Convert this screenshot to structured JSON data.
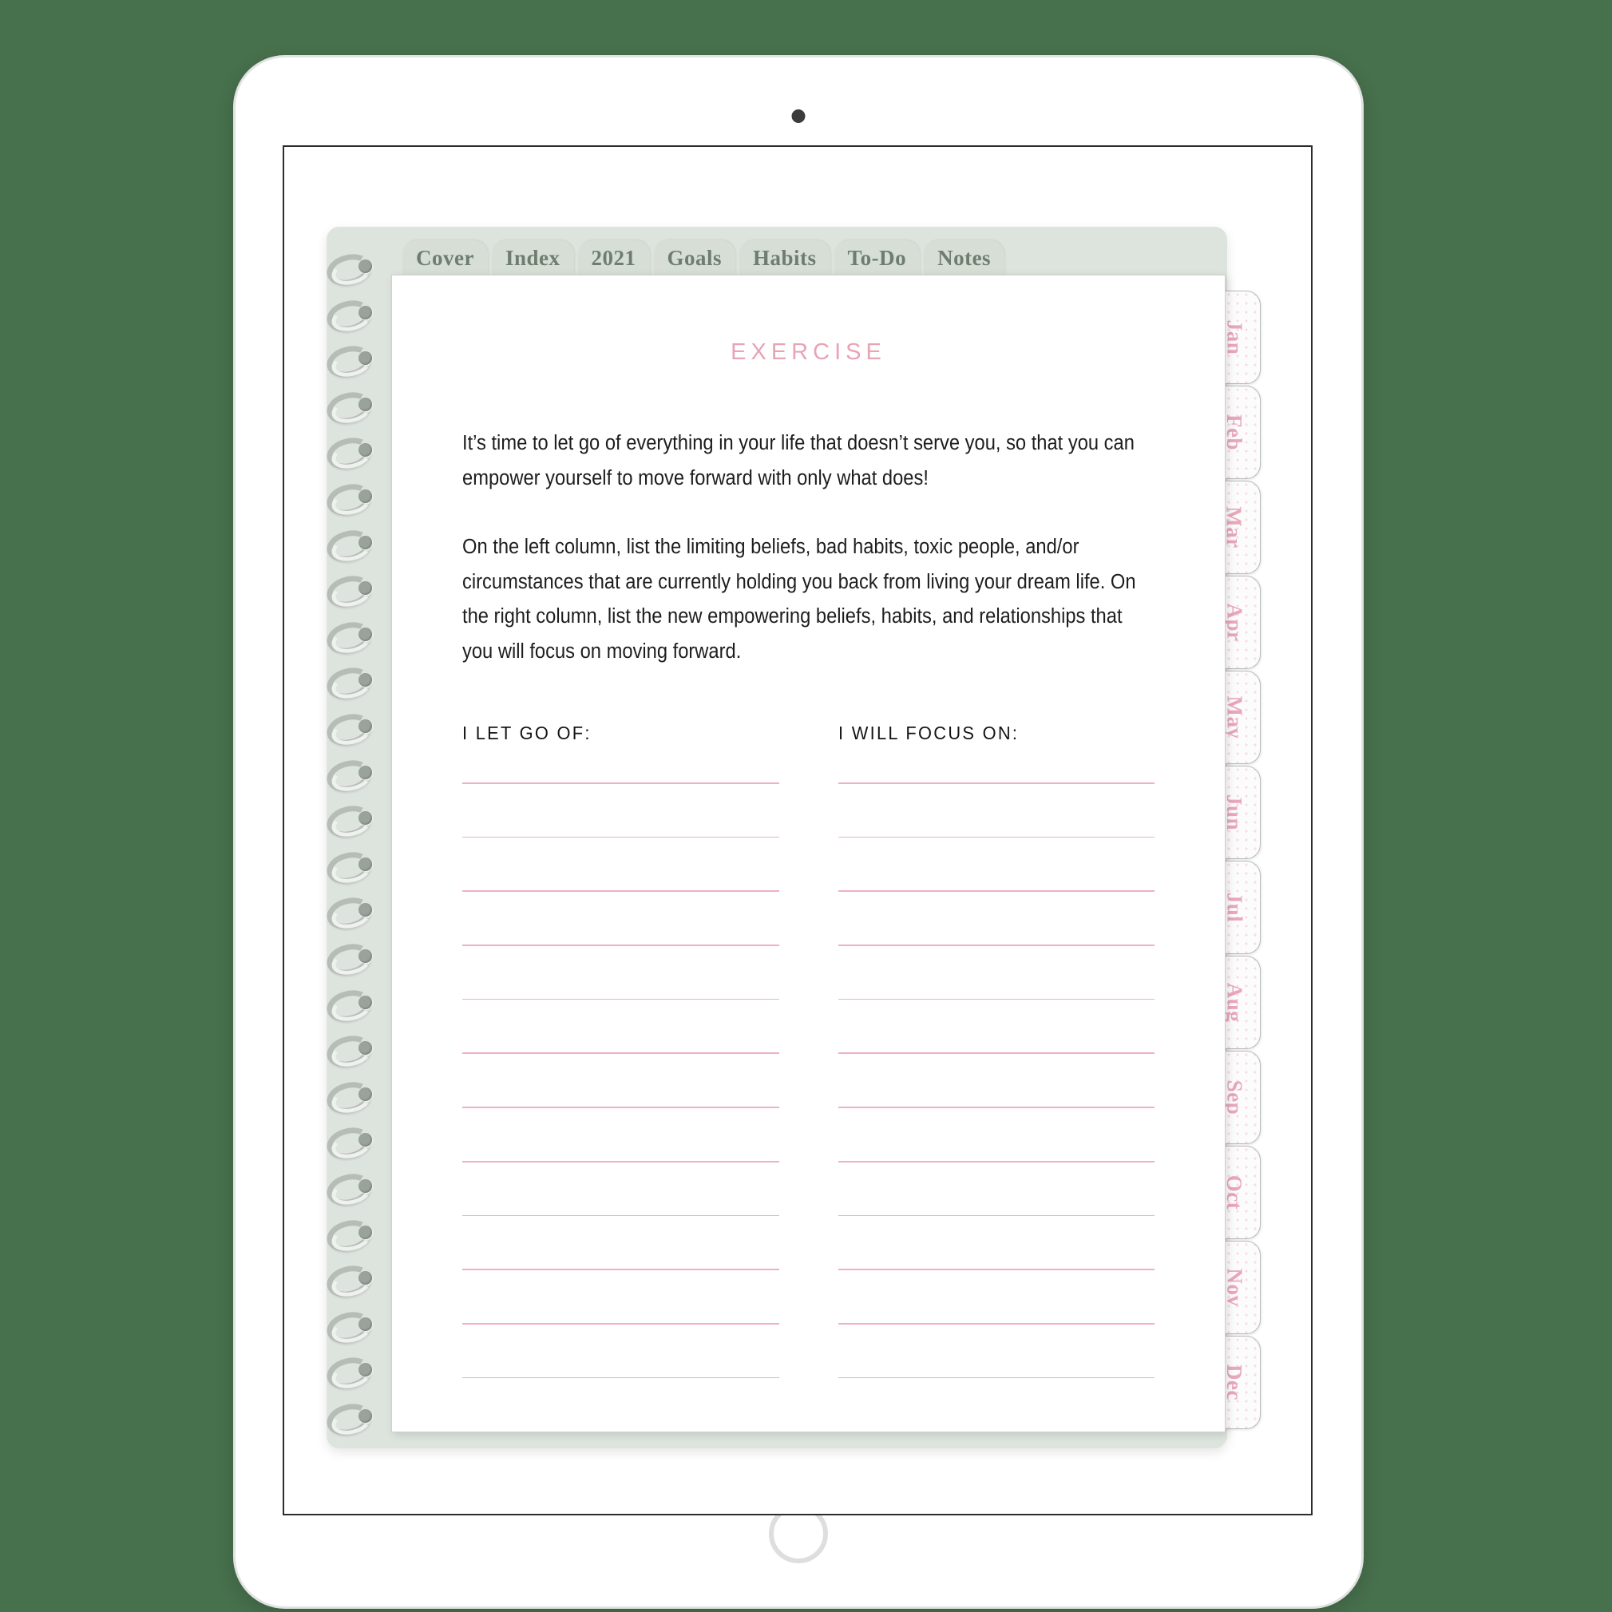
{
  "colors": {
    "background_green": "#47704c",
    "cover_sage": "#dde4dd",
    "tab_sage": "#d6ded6",
    "tab_text": "#6f7d70",
    "accent_pink": "#e8a3b5",
    "line_pink": "#f0b0c4",
    "body_text": "#1d1d1d",
    "device_white": "#ffffff"
  },
  "device": {
    "type": "tablet",
    "camera": "front-camera",
    "home_button": "home-button"
  },
  "top_tabs": [
    {
      "label": "Cover"
    },
    {
      "label": "Index"
    },
    {
      "label": "2021"
    },
    {
      "label": "Goals"
    },
    {
      "label": "Habits"
    },
    {
      "label": "To-Do"
    },
    {
      "label": "Notes"
    }
  ],
  "month_tabs": [
    {
      "label": "Jan"
    },
    {
      "label": "Feb"
    },
    {
      "label": "Mar"
    },
    {
      "label": "Apr"
    },
    {
      "label": "May"
    },
    {
      "label": "Jun"
    },
    {
      "label": "Jul"
    },
    {
      "label": "Aug"
    },
    {
      "label": "Sep"
    },
    {
      "label": "Oct"
    },
    {
      "label": "Nov"
    },
    {
      "label": "Dec"
    }
  ],
  "page": {
    "title": "EXERCISE",
    "paragraphs": [
      "It’s time to let go of everything in your life that doesn’t serve you, so that you can empower yourself to move forward with only what does!",
      "On the left column, list the limiting beliefs, bad habits, toxic people, and/or circumstances that are currently holding you back from living your dream life. On the right column, list the new empowering beliefs, habits, and relationships that you will focus on moving forward."
    ],
    "columns": [
      {
        "header": "I LET GO OF:",
        "line_count": 12
      },
      {
        "header": "I WILL FOCUS ON:",
        "line_count": 12
      }
    ]
  },
  "spiral": {
    "ring_count": 26
  }
}
